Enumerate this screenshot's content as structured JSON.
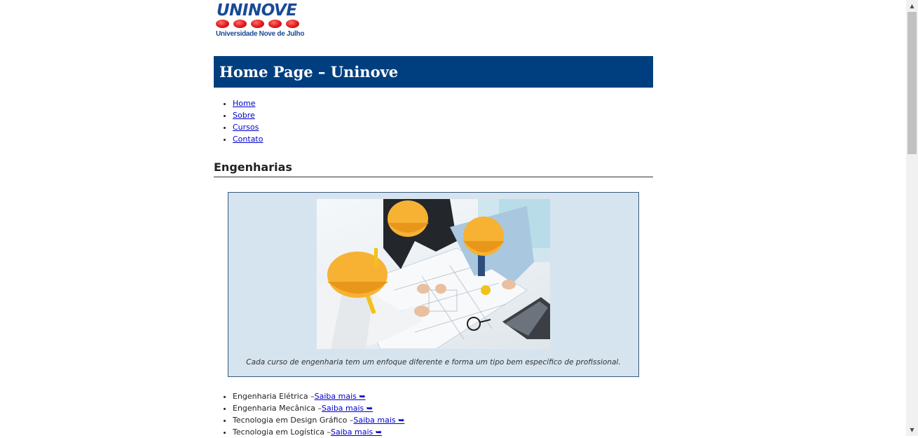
{
  "logo": {
    "name": "UNINOVE",
    "tagline": "Universidade Nove de Julho"
  },
  "header": {
    "title": "Home Page – Uninove"
  },
  "nav": {
    "items": [
      {
        "label": "Home"
      },
      {
        "label": "Sobre"
      },
      {
        "label": "Cursos"
      },
      {
        "label": "Contato"
      }
    ]
  },
  "section": {
    "title": "Engenharias"
  },
  "figure": {
    "caption": "Cada curso de engenharia tem um enfoque diferente e forma um tipo bem específico de profissional."
  },
  "courses": [
    {
      "name": "Engenharia Elétrica –",
      "link": "Saiba mais ➥"
    },
    {
      "name": "Engenharia Mecânica –",
      "link": "Saiba mais ➥"
    },
    {
      "name": "Tecnologia em Design Gráfico –",
      "link": "Saiba mais ➥"
    },
    {
      "name": "Tecnologia em Logística –",
      "link": "Saiba mais ➥"
    }
  ],
  "scrollbar": {
    "up_glyph": "▲",
    "down_glyph": "▼"
  },
  "colors": {
    "header_bg": "#003f7f",
    "figure_bg": "#d6e4ef",
    "link": "#0000cc",
    "logo_blue": "#1a4a96",
    "logo_red": "#e01a1a"
  }
}
